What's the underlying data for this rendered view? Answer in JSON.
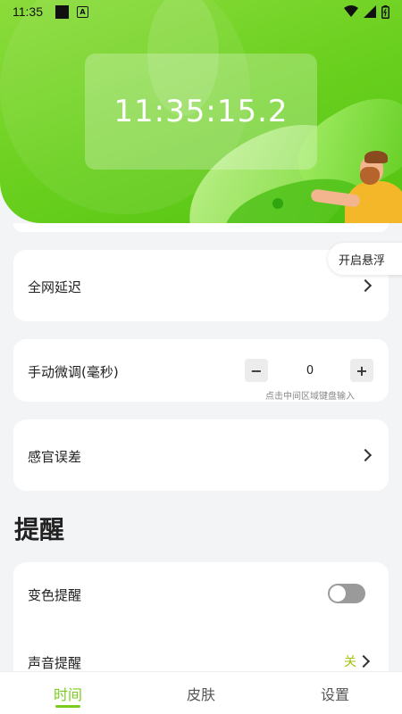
{
  "status_bar": {
    "time": "11:35",
    "icons": [
      "square-notification-icon",
      "a-notification-icon",
      "wifi-icon",
      "signal-icon",
      "battery-icon"
    ]
  },
  "clock": {
    "display": "11:35:15.2"
  },
  "float_button": {
    "label": "开启悬浮"
  },
  "network_delay": {
    "label": "全网延迟",
    "icon": "chevron-right-icon"
  },
  "manual_adjust": {
    "label": "手动微调(毫秒)",
    "minus": "−",
    "value": "0",
    "plus": "+",
    "hint": "点击中间区域键盘输入"
  },
  "sensory_error": {
    "label": "感官误差",
    "icon": "chevron-right-icon"
  },
  "reminder_section": {
    "title": "提醒",
    "color_change": {
      "label": "变色提醒",
      "toggle_on": false
    },
    "sound": {
      "label": "声音提醒",
      "value": "关"
    }
  },
  "bottom_nav": {
    "tabs": [
      {
        "label": "时间",
        "active": true
      },
      {
        "label": "皮肤",
        "active": false
      },
      {
        "label": "设置",
        "active": false
      }
    ]
  },
  "colors": {
    "accent": "#7acc1c",
    "hero_green": "#6bd01f",
    "off_value": "#a4c20c"
  }
}
